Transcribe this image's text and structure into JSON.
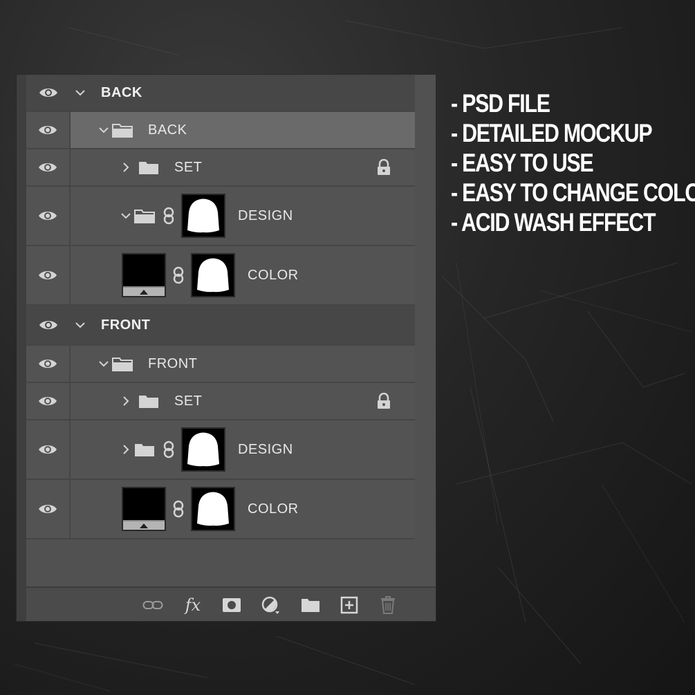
{
  "features": [
    "- PSD FILE",
    "- DETAILED MOCKUP",
    "- EASY TO USE",
    "- EASY TO CHANGE COLOR",
    "- ACID WASH EFFECT"
  ],
  "layers": {
    "back_group": "BACK",
    "back_folder": "BACK",
    "back_set": "SET",
    "back_design": "DESIGN",
    "back_color": "COLOR",
    "front_group": "FRONT",
    "front_folder": "FRONT",
    "front_set": "SET",
    "front_design": "DESIGN",
    "front_color": "COLOR"
  },
  "toolbar": {
    "fx_label": "fx"
  },
  "colors": {
    "panel": "#515151",
    "group_row": "#474747",
    "selected_row": "#6a6a6a",
    "text": "#e8e8e8"
  },
  "icons": {
    "visibility": "eye-icon",
    "expand": "chevron-down-icon",
    "collapse": "chevron-right-icon",
    "folder": "folder-icon",
    "lock": "lock-icon",
    "link": "link-icon"
  }
}
